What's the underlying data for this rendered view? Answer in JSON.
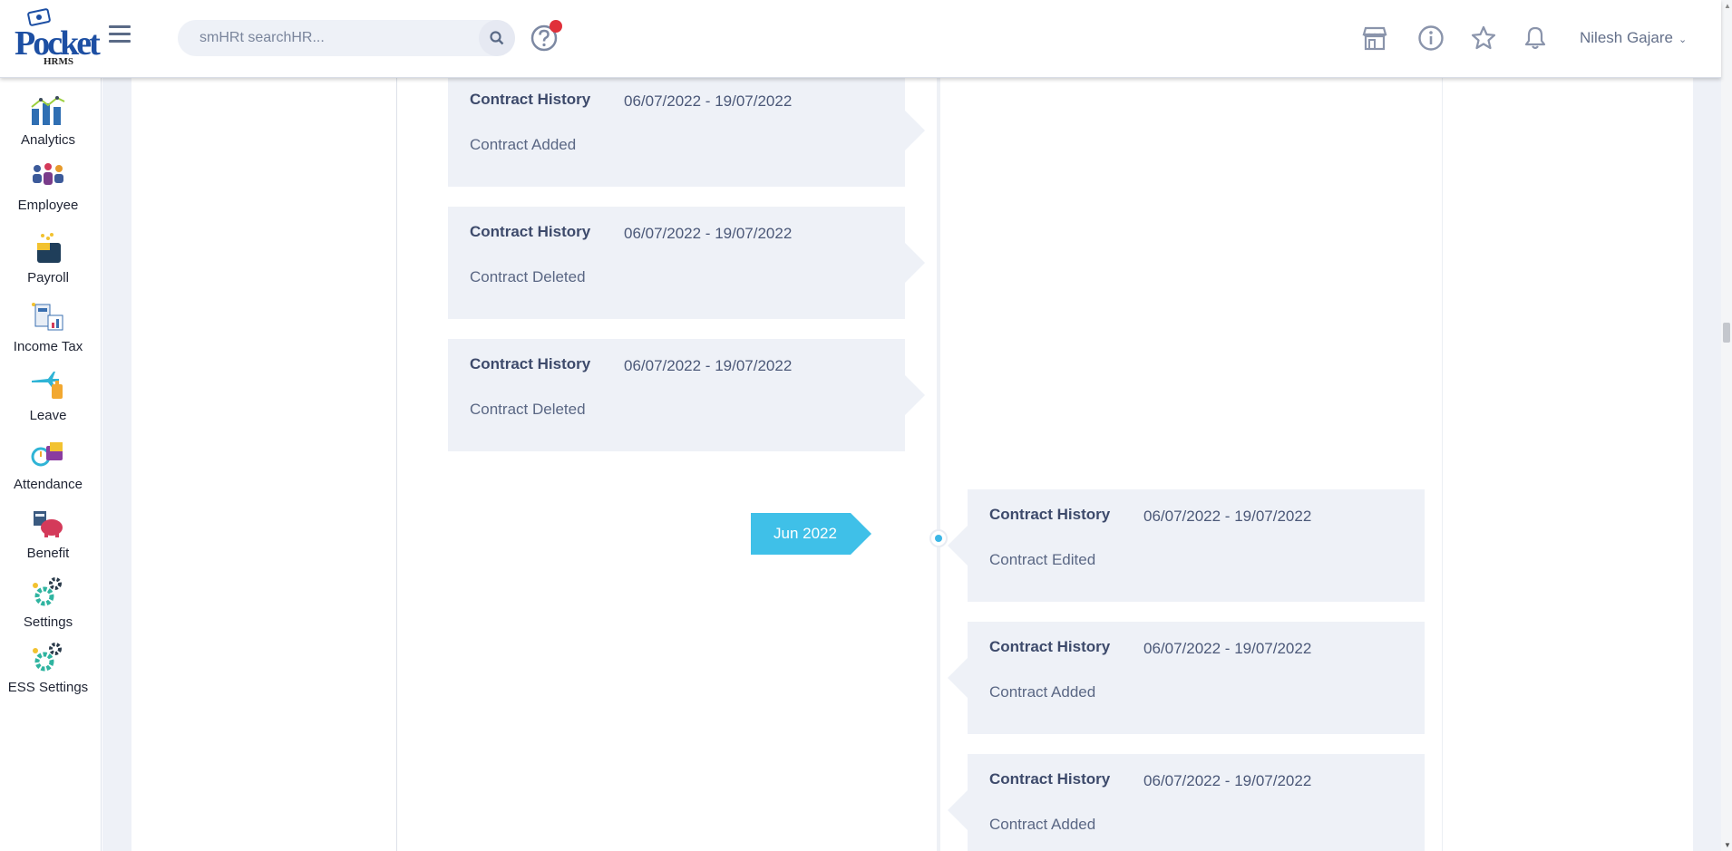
{
  "app": {
    "logo_text": "Pocket",
    "logo_sub": "HRMS",
    "search_placeholder": "smHRt searchHR...",
    "user_name": "Nilesh Gajare",
    "icons": [
      "menu-icon",
      "search-icon",
      "help-icon",
      "store-icon",
      "info-icon",
      "star-icon",
      "bell-icon"
    ],
    "notification_color": "#e0303a"
  },
  "sidebar": {
    "items": [
      {
        "label": "Analytics",
        "icon": "analytics-icon"
      },
      {
        "label": "Employee",
        "icon": "employee-icon"
      },
      {
        "label": "Payroll",
        "icon": "payroll-icon"
      },
      {
        "label": "Income Tax",
        "icon": "income-tax-icon"
      },
      {
        "label": "Leave",
        "icon": "leave-icon"
      },
      {
        "label": "Attendance",
        "icon": "attendance-icon"
      },
      {
        "label": "Benefit",
        "icon": "benefit-icon"
      },
      {
        "label": "Settings",
        "icon": "settings-icon"
      },
      {
        "label": "ESS Settings",
        "icon": "ess-settings-icon"
      }
    ]
  },
  "timeline": {
    "accent_color": "#3fc0e8",
    "month_label": "Jun 2022",
    "left_entries": [
      {
        "title": "Contract History",
        "date": "06/07/2022 - 19/07/2022",
        "description": "Contract Added"
      },
      {
        "title": "Contract History",
        "date": "06/07/2022 - 19/07/2022",
        "description": "Contract Deleted"
      },
      {
        "title": "Contract History",
        "date": "06/07/2022 - 19/07/2022",
        "description": "Contract Deleted"
      }
    ],
    "right_entries": [
      {
        "title": "Contract History",
        "date": "06/07/2022 - 19/07/2022",
        "description": "Contract Edited"
      },
      {
        "title": "Contract History",
        "date": "06/07/2022 - 19/07/2022",
        "description": "Contract Added"
      },
      {
        "title": "Contract History",
        "date": "06/07/2022 - 19/07/2022",
        "description": "Contract Added"
      }
    ]
  }
}
